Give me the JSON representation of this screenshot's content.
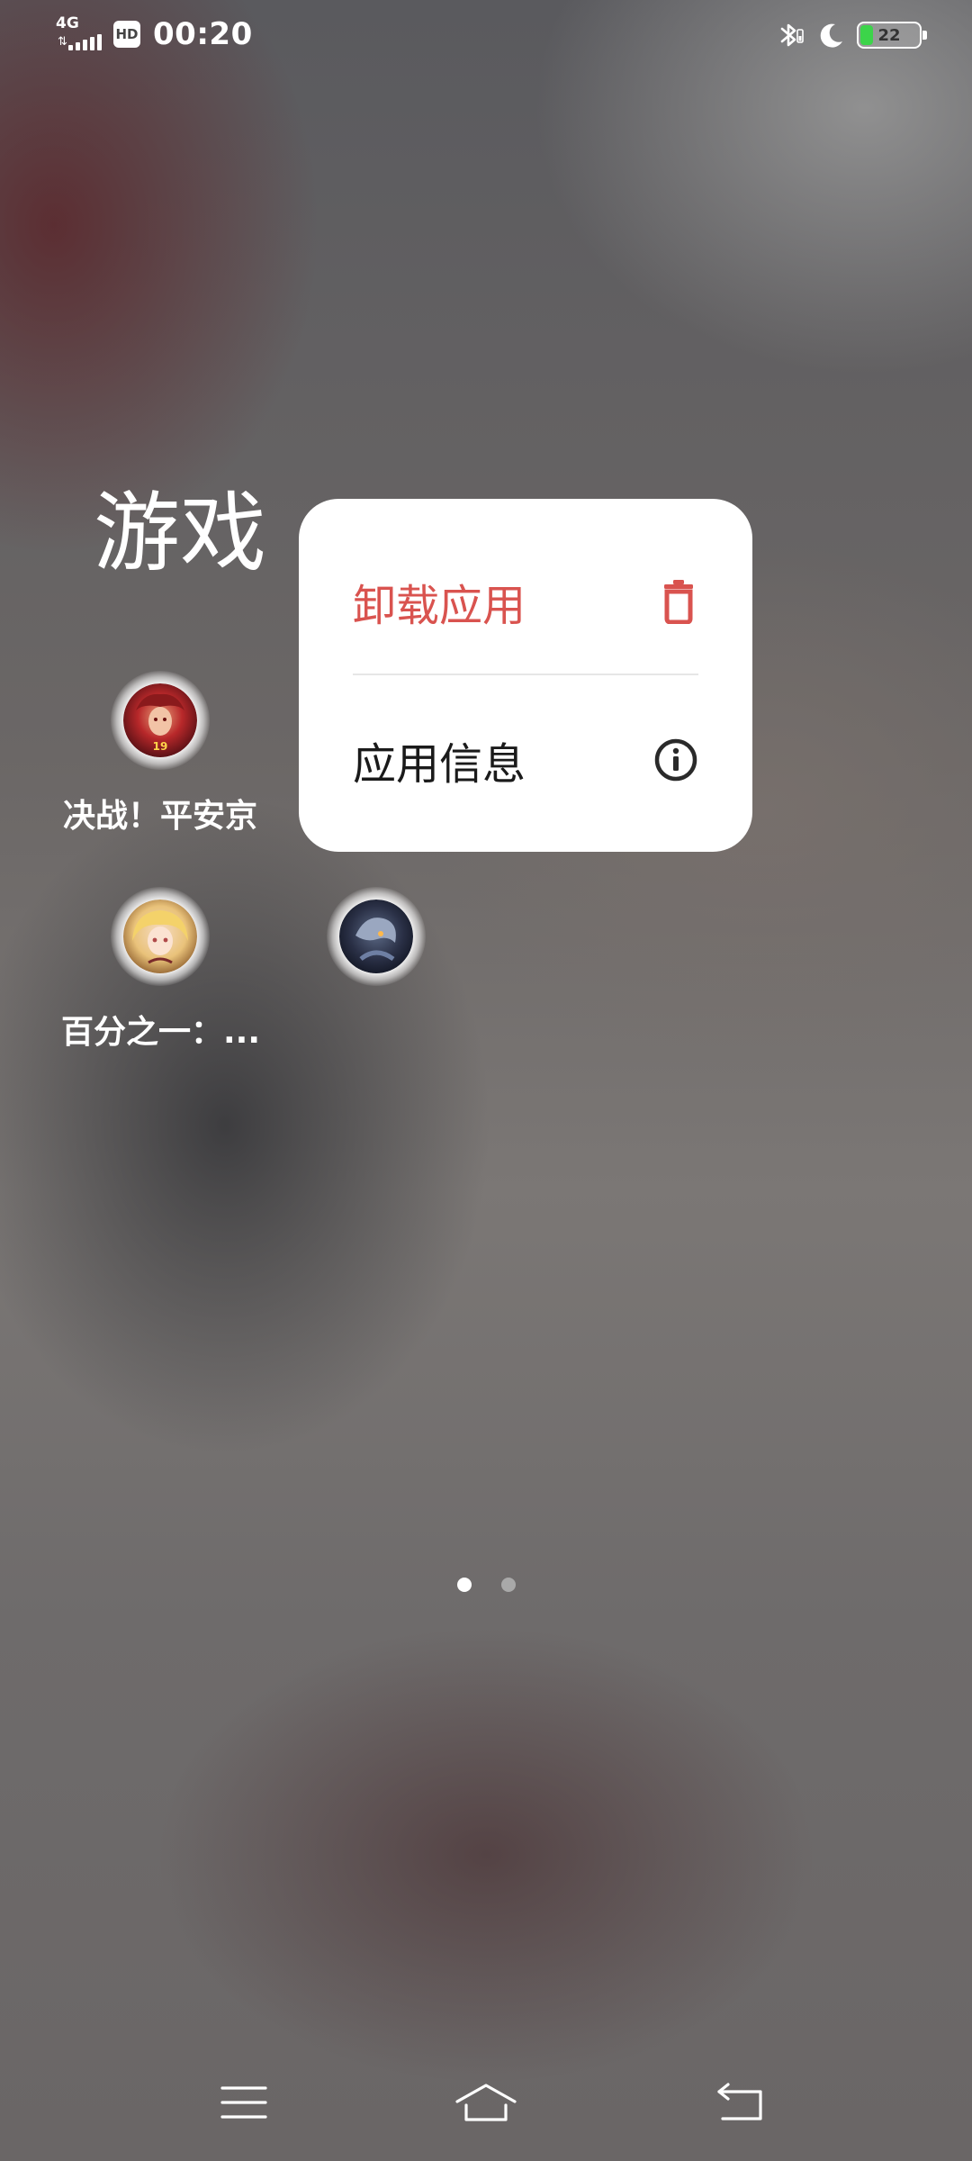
{
  "status_bar": {
    "network": "4G",
    "hd_badge": "HD",
    "time": "00:20",
    "battery_level": "22",
    "battery_color": "#3cd44a",
    "icons": [
      "signal-icon",
      "hd-icon",
      "bluetooth-icon",
      "do-not-disturb-moon-icon",
      "battery-icon"
    ]
  },
  "folder": {
    "title": "游戏",
    "apps": [
      {
        "label": "决战！平安京",
        "icon": "onmyoji-arena-app-icon"
      },
      {
        "label": "百分之一：...",
        "icon": "one-percent-app-icon"
      },
      {
        "label": "",
        "icon": "dark-armored-game-app-icon"
      }
    ]
  },
  "context_menu": {
    "items": [
      {
        "label": "卸载应用",
        "icon": "trash-icon",
        "color": "#d9534f"
      },
      {
        "label": "应用信息",
        "icon": "info-icon",
        "color": "#1a1a1a"
      }
    ]
  },
  "page_indicator": {
    "pages": 2,
    "current": 1,
    "active_color": "#ffffff",
    "inactive_color": "#a9a9a9"
  },
  "nav_bar": {
    "buttons": [
      {
        "name": "menu",
        "icon": "menu-icon"
      },
      {
        "name": "home",
        "icon": "home-icon"
      },
      {
        "name": "back",
        "icon": "back-icon"
      }
    ]
  }
}
